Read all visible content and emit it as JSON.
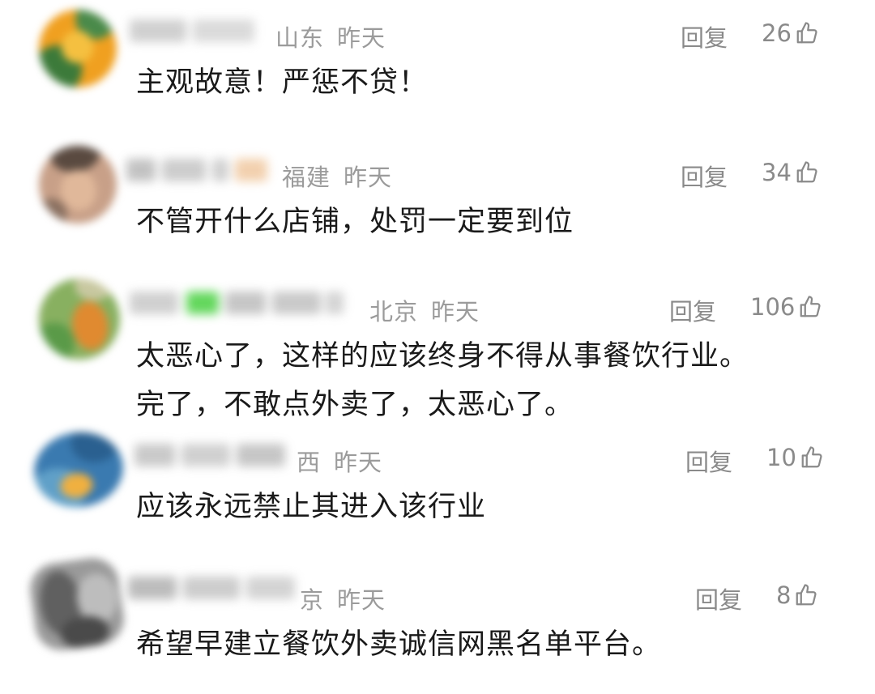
{
  "labels": {
    "reply": "回复"
  },
  "comments": [
    {
      "location": "山东",
      "time": "昨天",
      "likes": "26",
      "lines": [
        "主观故意！严惩不贷！"
      ]
    },
    {
      "location": "福建",
      "time": "昨天",
      "likes": "34",
      "lines": [
        "不管开什么店铺，处罚一定要到位"
      ]
    },
    {
      "location": "北京",
      "time": "昨天",
      "likes": "106",
      "lines": [
        "太恶心了，这样的应该终身不得从事餐饮行业。",
        "完了，不敢点外卖了，太恶心了。"
      ]
    },
    {
      "location": "西",
      "time": "昨天",
      "likes": "10",
      "lines": [
        "应该永远禁止其进入该行业"
      ]
    },
    {
      "location": "京",
      "time": "昨天",
      "likes": "8",
      "lines": [
        "希望早建立餐饮外卖诚信网黑名单平台。"
      ]
    }
  ],
  "colors": {
    "text": "#1a1a1a",
    "meta": "#9b9b9b",
    "action": "#8a8a8a"
  }
}
